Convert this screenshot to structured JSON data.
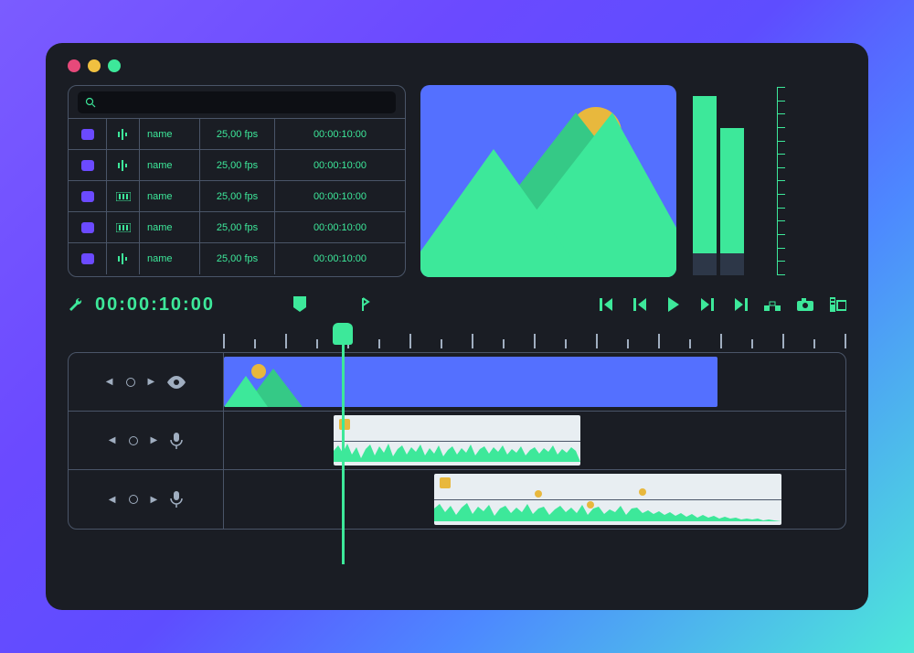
{
  "colors": {
    "accent": "#3de89a",
    "bg": "#1a1d24",
    "preview_sky": "#5470ff",
    "sun": "#e8b83d"
  },
  "search": {
    "placeholder": ""
  },
  "bin": {
    "rows": [
      {
        "name": "name",
        "fps": "25,00 fps",
        "tc": "00:00:10:00",
        "icon": "audio-levels-icon"
      },
      {
        "name": "name",
        "fps": "25,00 fps",
        "tc": "00:00:10:00",
        "icon": "audio-levels-icon"
      },
      {
        "name": "name",
        "fps": "25,00 fps",
        "tc": "00:00:10:00",
        "icon": "sequence-icon"
      },
      {
        "name": "name",
        "fps": "25,00 fps",
        "tc": "00:00:10:00",
        "icon": "sequence-icon"
      },
      {
        "name": "name",
        "fps": "25,00 fps",
        "tc": "00:00:10:00",
        "icon": "audio-levels-icon"
      }
    ]
  },
  "transport": {
    "timecode": "00:00:10:00"
  },
  "meters": {
    "left_pct": 95,
    "right_pct": 78
  },
  "tracks": [
    {
      "type": "video",
      "icon": "eye-icon"
    },
    {
      "type": "audio",
      "icon": "mic-icon"
    },
    {
      "type": "audio",
      "icon": "mic-icon"
    }
  ]
}
